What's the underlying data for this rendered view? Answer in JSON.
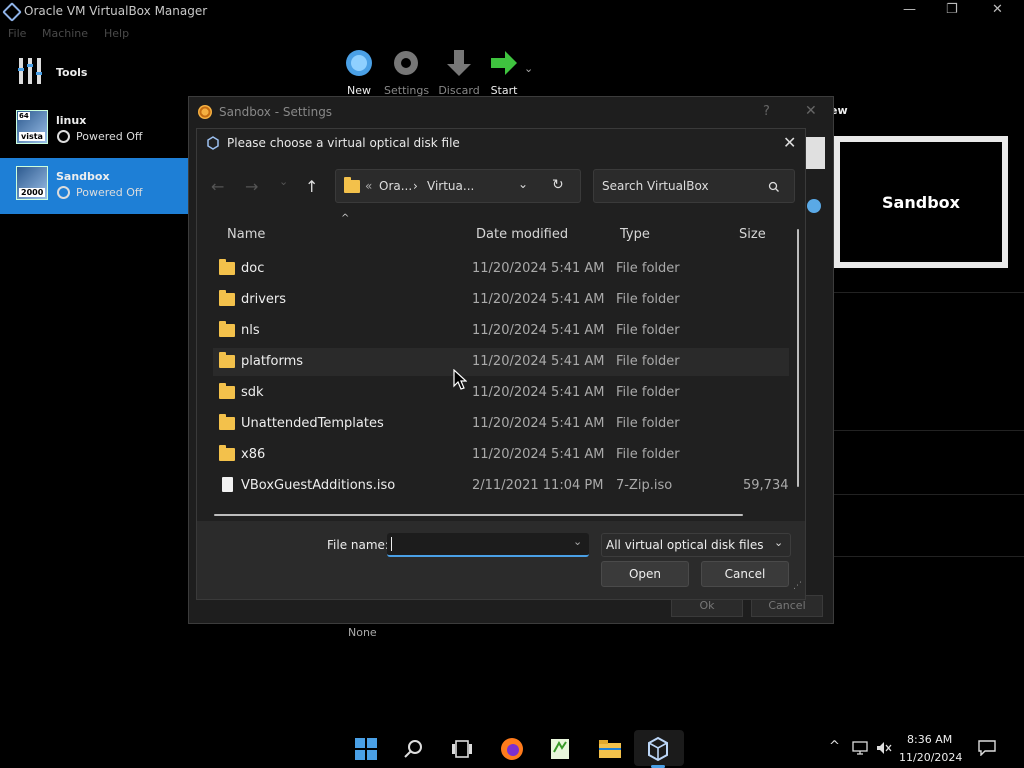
{
  "window": {
    "title": "Oracle VM VirtualBox Manager",
    "controls": {
      "minimize": "—",
      "maximize": "❐",
      "close": "✕"
    }
  },
  "menu": [
    "File",
    "Machine",
    "Help"
  ],
  "sidebar": {
    "tools_label": "Tools",
    "vms": [
      {
        "name": "linux",
        "state": "Powered Off",
        "badge": "64",
        "badge2": "vista"
      },
      {
        "name": "Sandbox",
        "state": "Powered Off",
        "badge": "2000"
      }
    ]
  },
  "toolbar": {
    "new": "New",
    "settings": "Settings",
    "discard": "Discard",
    "start": "Start"
  },
  "preview": {
    "label": "ew",
    "vm_name": "Sandbox"
  },
  "details": {
    "none_label": "None"
  },
  "settings_dialog": {
    "title": "Sandbox - Settings",
    "help": "?",
    "close": "✕",
    "ok": "Ok",
    "cancel": "Cancel"
  },
  "file_dialog": {
    "title": "Please choose a virtual optical disk file",
    "close": "✕",
    "nav": {
      "back": "←",
      "forward": "→",
      "recent": "⌄",
      "up": "↑"
    },
    "address": {
      "prefix": "«",
      "part1": "Ora...",
      "sep": "›",
      "part2": "Virtua...",
      "dropdown": "⌄",
      "refresh": "↻"
    },
    "search_placeholder": "Search VirtualBox",
    "columns": {
      "name": "Name",
      "date": "Date modified",
      "type": "Type",
      "size": "Size"
    },
    "rows": [
      {
        "name": "doc",
        "date": "11/20/2024 5:41 AM",
        "type": "File folder",
        "size": "",
        "kind": "folder"
      },
      {
        "name": "drivers",
        "date": "11/20/2024 5:41 AM",
        "type": "File folder",
        "size": "",
        "kind": "folder"
      },
      {
        "name": "nls",
        "date": "11/20/2024 5:41 AM",
        "type": "File folder",
        "size": "",
        "kind": "folder"
      },
      {
        "name": "platforms",
        "date": "11/20/2024 5:41 AM",
        "type": "File folder",
        "size": "",
        "kind": "folder"
      },
      {
        "name": "sdk",
        "date": "11/20/2024 5:41 AM",
        "type": "File folder",
        "size": "",
        "kind": "folder"
      },
      {
        "name": "UnattendedTemplates",
        "date": "11/20/2024 5:41 AM",
        "type": "File folder",
        "size": "",
        "kind": "folder"
      },
      {
        "name": "x86",
        "date": "11/20/2024 5:41 AM",
        "type": "File folder",
        "size": "",
        "kind": "folder"
      },
      {
        "name": "VBoxGuestAdditions.iso",
        "date": "2/11/2021 11:04 PM",
        "type": "7-Zip.iso",
        "size": "59,734",
        "kind": "file"
      }
    ],
    "file_name_label": "File name:",
    "file_name_value": "",
    "file_type": "All virtual optical disk files (*.dr",
    "open": "Open",
    "cancel": "Cancel"
  },
  "taskbar": {
    "time": "8:36 AM",
    "date": "11/20/2024",
    "tray_chevron": "^"
  },
  "colors": {
    "accent": "#4aa0e6",
    "selected_vm": "#1e7fd6",
    "folder": "#f3c14b"
  }
}
